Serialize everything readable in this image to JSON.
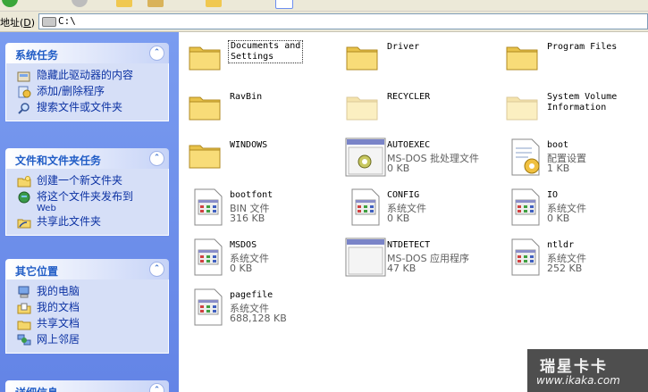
{
  "address": {
    "label": "地址",
    "hotkey": "D",
    "value": "C:\\"
  },
  "left_pane": {
    "system_tasks": {
      "title": "系统任务",
      "items": [
        "隐藏此驱动器的内容",
        "添加/删除程序",
        "搜索文件或文件夹"
      ]
    },
    "file_tasks": {
      "title": "文件和文件夹任务",
      "items": [
        {
          "label": "创建一个新文件夹",
          "sub": ""
        },
        {
          "label": "将这个文件夹发布到",
          "sub": "Web"
        },
        {
          "label": "共享此文件夹",
          "sub": ""
        }
      ]
    },
    "other_places": {
      "title": "其它位置",
      "items": [
        "我的电脑",
        "我的文档",
        "共享文档",
        "网上邻居"
      ]
    },
    "details": {
      "title": "详细信息"
    }
  },
  "files": [
    {
      "name": "Documents and\nSettings",
      "type": "",
      "size": "",
      "icon": "folder-icon",
      "selected": true
    },
    {
      "name": "Driver",
      "type": "",
      "size": "",
      "icon": "folder-icon"
    },
    {
      "name": "Program Files",
      "type": "",
      "size": "",
      "icon": "folder-icon"
    },
    {
      "name": "RavBin",
      "type": "",
      "size": "",
      "icon": "folder-icon"
    },
    {
      "name": "RECYCLER",
      "type": "",
      "size": "",
      "icon": "hidden-folder-icon"
    },
    {
      "name": "System Volume\nInformation",
      "type": "",
      "size": "",
      "icon": "hidden-folder-icon"
    },
    {
      "name": "WINDOWS",
      "type": "",
      "size": "",
      "icon": "folder-icon"
    },
    {
      "name": "AUTOEXEC",
      "type": "MS-DOS 批处理文件",
      "size": "0 KB",
      "icon": "batch-file-icon"
    },
    {
      "name": "boot",
      "type": "配置设置",
      "size": "1 KB",
      "icon": "config-file-icon"
    },
    {
      "name": "bootfont",
      "type": "BIN 文件",
      "size": "316 KB",
      "icon": "system-file-icon"
    },
    {
      "name": "CONFIG",
      "type": "系统文件",
      "size": "0 KB",
      "icon": "system-file-icon"
    },
    {
      "name": "IO",
      "type": "系统文件",
      "size": "0 KB",
      "icon": "system-file-icon"
    },
    {
      "name": "MSDOS",
      "type": "系统文件",
      "size": "0 KB",
      "icon": "system-file-icon"
    },
    {
      "name": "NTDETECT",
      "type": "MS-DOS 应用程序",
      "size": "47 KB",
      "icon": "dos-app-icon"
    },
    {
      "name": "ntldr",
      "type": "系统文件",
      "size": "252 KB",
      "icon": "system-file-icon"
    },
    {
      "name": "pagefile",
      "type": "系统文件",
      "size": "688,128 KB",
      "icon": "system-file-icon"
    }
  ],
  "watermark": {
    "brand": "瑞星卡卡",
    "url": "www.ikaka.com"
  },
  "colors": {
    "pane_blue": "#6d8ff0",
    "link_blue": "#0c32a3",
    "header_blue": "#215dc6",
    "folder_yellow": "#f4d66a"
  }
}
